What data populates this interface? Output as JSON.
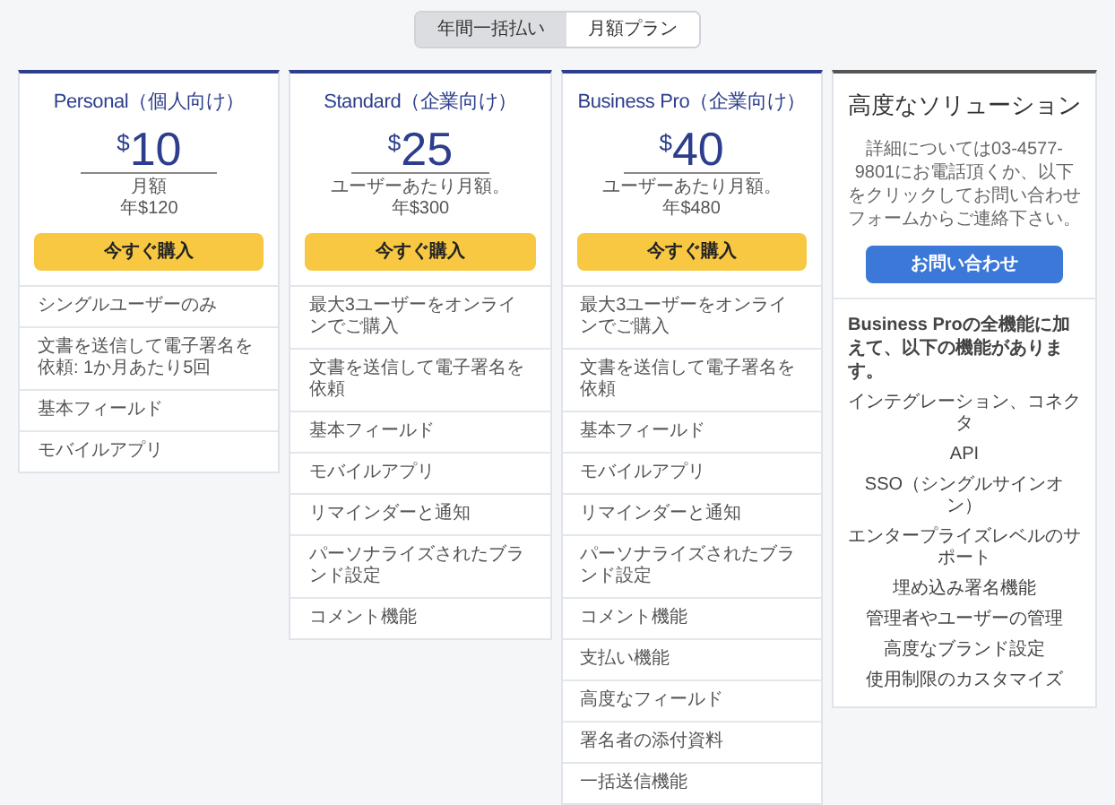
{
  "billing_toggle": [
    {
      "label": "年間一括払い",
      "selected": true
    },
    {
      "label": "月額プラン",
      "selected": false
    }
  ],
  "plans": [
    {
      "kind": "plan",
      "title": "Personal（個人向け）",
      "currency": "$",
      "price": "10",
      "price_note": "月額",
      "annual": "年$120",
      "button": "今すぐ購入",
      "features": [
        "シングルユーザーのみ",
        "文書を送信して電子署名を依頼: 1か月あたり5回",
        "基本フィールド",
        "モバイルアプリ"
      ]
    },
    {
      "kind": "plan",
      "title": "Standard（企業向け）",
      "currency": "$",
      "price": "25",
      "price_note": "ユーザーあたり月額。",
      "annual": "年$300",
      "button": "今すぐ購入",
      "features": [
        "最大3ユーザーをオンラインでご購入",
        "文書を送信して電子署名を依頼",
        "基本フィールド",
        "モバイルアプリ",
        "リマインダーと通知",
        "パーソナライズされたブランド設定",
        "コメント機能"
      ]
    },
    {
      "kind": "plan",
      "title": "Business Pro（企業向け）",
      "currency": "$",
      "price": "40",
      "price_note": "ユーザーあたり月額。",
      "annual": "年$480",
      "button": "今すぐ購入",
      "features": [
        "最大3ユーザーをオンラインでご購入",
        "文書を送信して電子署名を依頼",
        "基本フィールド",
        "モバイルアプリ",
        "リマインダーと通知",
        "パーソナライズされたブランド設定",
        "コメント機能",
        "支払い機能",
        "高度なフィールド",
        "署名者の添付資料",
        "一括送信機能"
      ]
    },
    {
      "kind": "contact",
      "title": "高度なソリューション",
      "description": "詳細については03-4577-9801にお電話頂くか、以下をクリックしてお問い合わせフォームからご連絡下さい。",
      "button": "お問い合わせ",
      "intro": "Business Proの全機能に加えて、以下の機能があります。",
      "features": [
        "インテグレーション、コネクタ",
        "API",
        "SSO（シングルサインオン）",
        "エンタープライズレベルのサポート",
        "埋め込み署名機能",
        "管理者やユーザーの管理",
        "高度なブランド設定",
        "使用制限のカスタマイズ"
      ]
    }
  ]
}
